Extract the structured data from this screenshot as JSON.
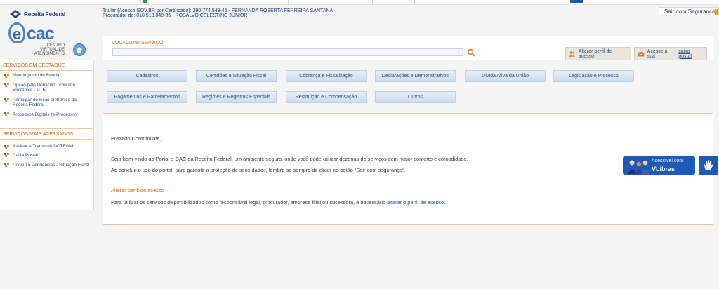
{
  "brand": {
    "rf_name": "Receita Federal",
    "ecac_title": "cac",
    "ecac_letter": "e",
    "ecac_subtitle": "CENTRO VIRTUAL DE ATENDIMENTO"
  },
  "user": {
    "line1": "Titular (Acesso GOV.BR por Certificado): 290.774.548-45 - FERNANDA ROBERTA FERREIRA SANTANA",
    "line2": "Procurador de: 018.513.048-86 - ROSALVO CELESTINO JUNIOR"
  },
  "logout_label": "Sair com Segurança",
  "search": {
    "label": "LOCALIZAR SERVIÇO",
    "value": "",
    "placeholder": ""
  },
  "actions": {
    "alterar_perfil": "Alterar perfil de acesso",
    "caixa_prefix": "Acesse a sua ",
    "caixa_link": "caixa postal"
  },
  "sidebar": {
    "destaque_title": "SERVIÇOS EM DESTAQUE",
    "destaque": [
      "Meu Imposto de Renda",
      "Opção pelo Domicílio Tributário Eletrônico - DTE",
      "Participar de leilão eletrônico da Receita Federal",
      "Processos Digitais (e-Processo)"
    ],
    "acessados_title": "SERVIÇOS MAIS ACESSADOS",
    "acessados": [
      "Assinar e Transmitir DCTFWeb",
      "Caixa Postal",
      "Consulta Pendências - Situação Fiscal"
    ]
  },
  "menu": [
    "Cadastros",
    "Certidões e Situação Fiscal",
    "Cobrança e Fiscalização",
    "Declarações e Demonstrativos",
    "Dívida Ativa da União",
    "Legislação e Processo",
    "Pagamentos e Parcelamentos",
    "Regimes e Registros Especiais",
    "Restituição e Compensação",
    "Outros"
  ],
  "content": {
    "greeting": "Prezado Contribuinte,",
    "welcome": "Seja bem-vindo ao Portal e-CAC da Receita Federal, um ambiente seguro, onde você pode utilizar dezenas de serviços com maior conforto e comodidade.",
    "reminder": "Ao concluir o uso do portal, para garantir a proteção de seus dados, lembre-se sempre de clicar no botão \"Sair com segurança\".",
    "alt_title": "Alterar perfil de acesso",
    "alt_text": "Para utilizar os serviços disponibilizados como responsável legal, procurador, empresa filial ou sucessora, é necessário ",
    "alt_link": "alterar o perfil de acesso",
    "alt_end": "."
  },
  "vlibras": {
    "line1": "Acessível com",
    "line2": "VLibras"
  },
  "colors": {
    "accent_orange": "#d46a1a",
    "link_blue": "#2a5fa0",
    "vlibras_blue": "#1b5bb6"
  }
}
